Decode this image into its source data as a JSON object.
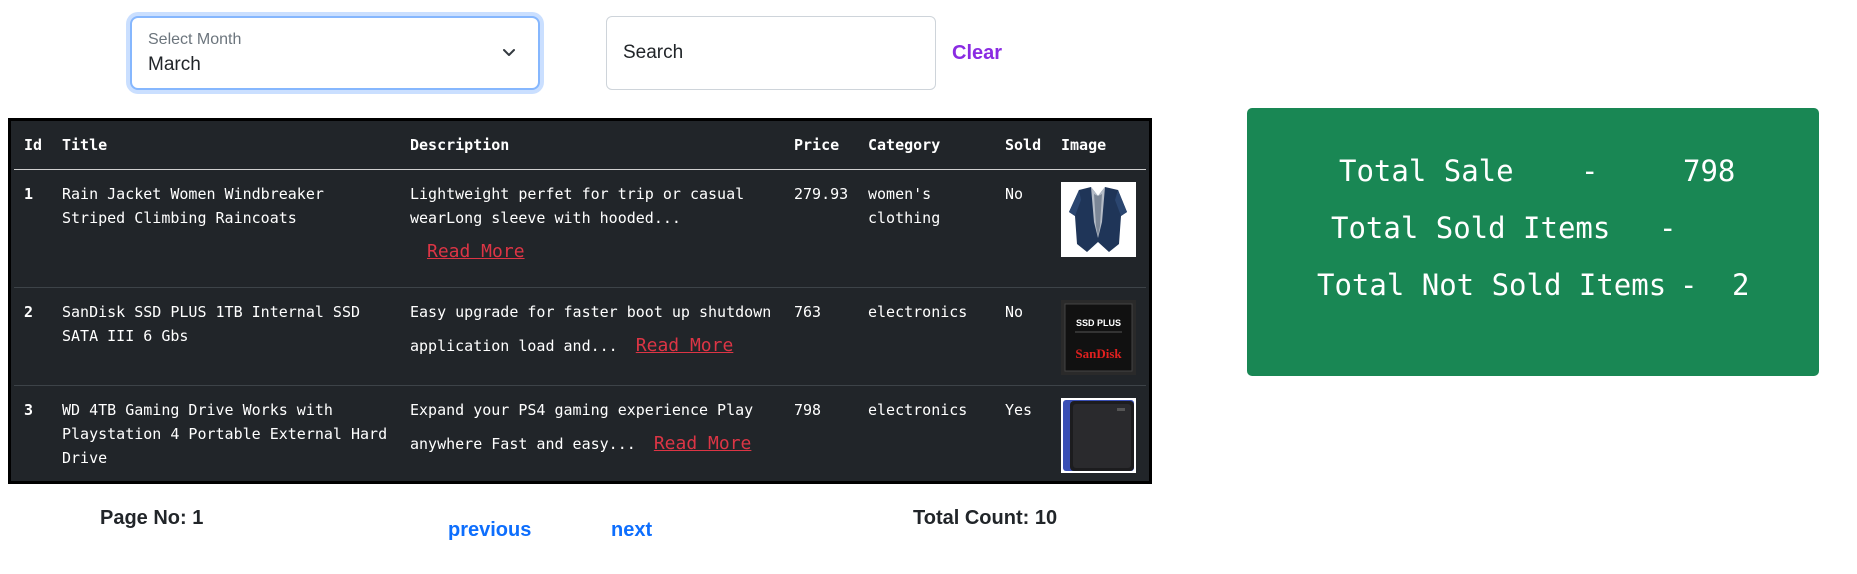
{
  "filters": {
    "month_label": "Select Month",
    "month_value": "March",
    "search_placeholder": "Search",
    "clear_label": "Clear"
  },
  "table": {
    "headers": [
      "Id",
      "Title",
      "Description",
      "Price",
      "Category",
      "Sold",
      "Image"
    ],
    "read_more_label": "Read More",
    "rows": [
      {
        "id": "1",
        "title": "Rain Jacket Women Windbreaker Striped Climbing Raincoats",
        "description": "Lightweight perfet for trip or casual wearLong sleeve with hooded...",
        "price": "279.93",
        "category": "women's clothing",
        "sold": "No",
        "image": "jacket-image"
      },
      {
        "id": "2",
        "title": "SanDisk SSD PLUS 1TB Internal SSD SATA III 6 Gbs",
        "description": "Easy upgrade for faster boot up shutdown application load and...",
        "price": "763",
        "category": "electronics",
        "sold": "No",
        "image": "ssd-image",
        "image_text_top": "SSD PLUS",
        "image_text_brand": "SanDisk"
      },
      {
        "id": "3",
        "title": "WD 4TB Gaming Drive Works with Playstation 4 Portable External Hard Drive",
        "description": "Expand your PS4 gaming experience Play anywhere Fast and easy...",
        "price": "798",
        "category": "electronics",
        "sold": "Yes",
        "image": "hard-drive-image"
      }
    ]
  },
  "stats": {
    "total_sale_label": "Total Sale",
    "total_sale_value": "798",
    "total_sold_label": "Total Sold Items",
    "total_sold_value": "",
    "total_not_sold_label": "Total Not Sold Items",
    "total_not_sold_value": "2",
    "separator": "-",
    "card_color": "#198754"
  },
  "footer": {
    "page_label": "Page No: 1",
    "previous_label": "previous",
    "next_label": "next",
    "total_count_label": "Total Count: 10"
  }
}
